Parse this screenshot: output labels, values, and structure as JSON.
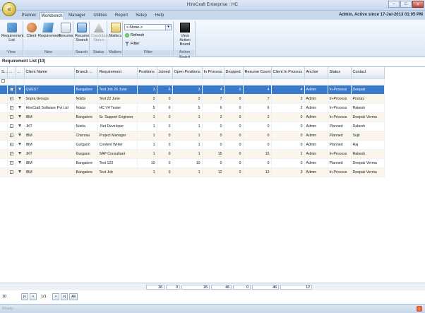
{
  "window": {
    "title": "HireCraft Enterprise : HC",
    "status_text": "Admin, Active since 17-Jul-2013 01:05 PM"
  },
  "tabs": [
    {
      "label": "Planner"
    },
    {
      "label": "Workbench"
    },
    {
      "label": "Manager"
    },
    {
      "label": "Utilities"
    },
    {
      "label": "Report"
    },
    {
      "label": "Setup"
    },
    {
      "label": "Help"
    }
  ],
  "ribbon": {
    "view": {
      "button": "Requirement List",
      "group": "View"
    },
    "new": {
      "client": "Client",
      "requirement": "Requirement",
      "resume": "Resume",
      "group": "New"
    },
    "search": {
      "button": "Resume Search",
      "group": "Search"
    },
    "status": {
      "button": "Candidate Status",
      "group": "Status"
    },
    "mailers": {
      "button": "Mailers",
      "group": "Mailers"
    },
    "filter": {
      "select": "<-None->",
      "refresh": "Refresh",
      "filter": "Filter",
      "group": "Filter"
    },
    "action": {
      "button": "View Action Board",
      "group": "Action Board"
    }
  },
  "grid": {
    "title": "Requirement List (10)",
    "columns": [
      "S...",
      "...",
      "...",
      "Client Name",
      "Branch ...",
      "Requirement",
      "Positions",
      "Joined",
      "Open Positions",
      "In Process",
      "Dropped",
      "Resume Count",
      "Client In Process",
      "Anchor",
      "Status",
      "Contact"
    ],
    "rows": [
      [
        "QUEST",
        "Bangalore",
        "Test Job 26 June",
        "3",
        "0",
        "3",
        "4",
        "0",
        "4",
        "4",
        "Admin",
        "In-Process",
        "Deepak"
      ],
      [
        "Sopra Groups",
        "Noida",
        "Test 22 June",
        "2",
        "0",
        "2",
        "7",
        "0",
        "7",
        "2",
        "Admin",
        "In-Process",
        "Pranav"
      ],
      [
        "HireCraft Software Pvt Ltd",
        "Noida",
        "HC V4 Tester",
        "5",
        "0",
        "5",
        "6",
        "0",
        "6",
        "2",
        "Admin",
        "In-Process",
        "Rakesh"
      ],
      [
        "IBM",
        "Bangalore",
        "Sr. Support Engineer",
        "1",
        "0",
        "1",
        "2",
        "0",
        "2",
        "0",
        "Admin",
        "In-Process",
        "Deepak Verma"
      ],
      [
        "JKT",
        "Noida",
        ".Net Developer",
        "1",
        "0",
        "1",
        "0",
        "0",
        "0",
        "0",
        "Admin",
        "Planned",
        "Rakesh"
      ],
      [
        "IBM",
        "Chennai",
        "Project Manager",
        "1",
        "0",
        "1",
        "0",
        "0",
        "0",
        "0",
        "Admin",
        "Planned",
        "Sujit"
      ],
      [
        "IBM",
        "Gurgaon",
        "Content Writer",
        "1",
        "0",
        "1",
        "0",
        "0",
        "0",
        "0",
        "Admin",
        "Planned",
        "Raj"
      ],
      [
        "JKT",
        "Gurgaon",
        "SAP Consultant",
        "1",
        "0",
        "1",
        "15",
        "0",
        "15",
        "1",
        "Admin",
        "In-Process",
        "Rakesh"
      ],
      [
        "IBM",
        "Bangalore",
        "Test 123",
        "10",
        "0",
        "10",
        "0",
        "0",
        "0",
        "0",
        "Admin",
        "Planned",
        "Deepak Verma"
      ],
      [
        "IBM",
        "Bangalore",
        "Test Job",
        "1",
        "0",
        "1",
        "12",
        "0",
        "12",
        "3",
        "Admin",
        "In-Process",
        "Deepak Verma"
      ]
    ],
    "totals": {
      "positions": "26",
      "joined": "0",
      "open": "26",
      "in_process": "46",
      "dropped": "0",
      "resume_count": "46",
      "client_in_process": "12"
    }
  },
  "pager": {
    "page_size": "10",
    "page": "1/1",
    "all": "All"
  },
  "statusbar": {
    "text": "Ready ..."
  }
}
